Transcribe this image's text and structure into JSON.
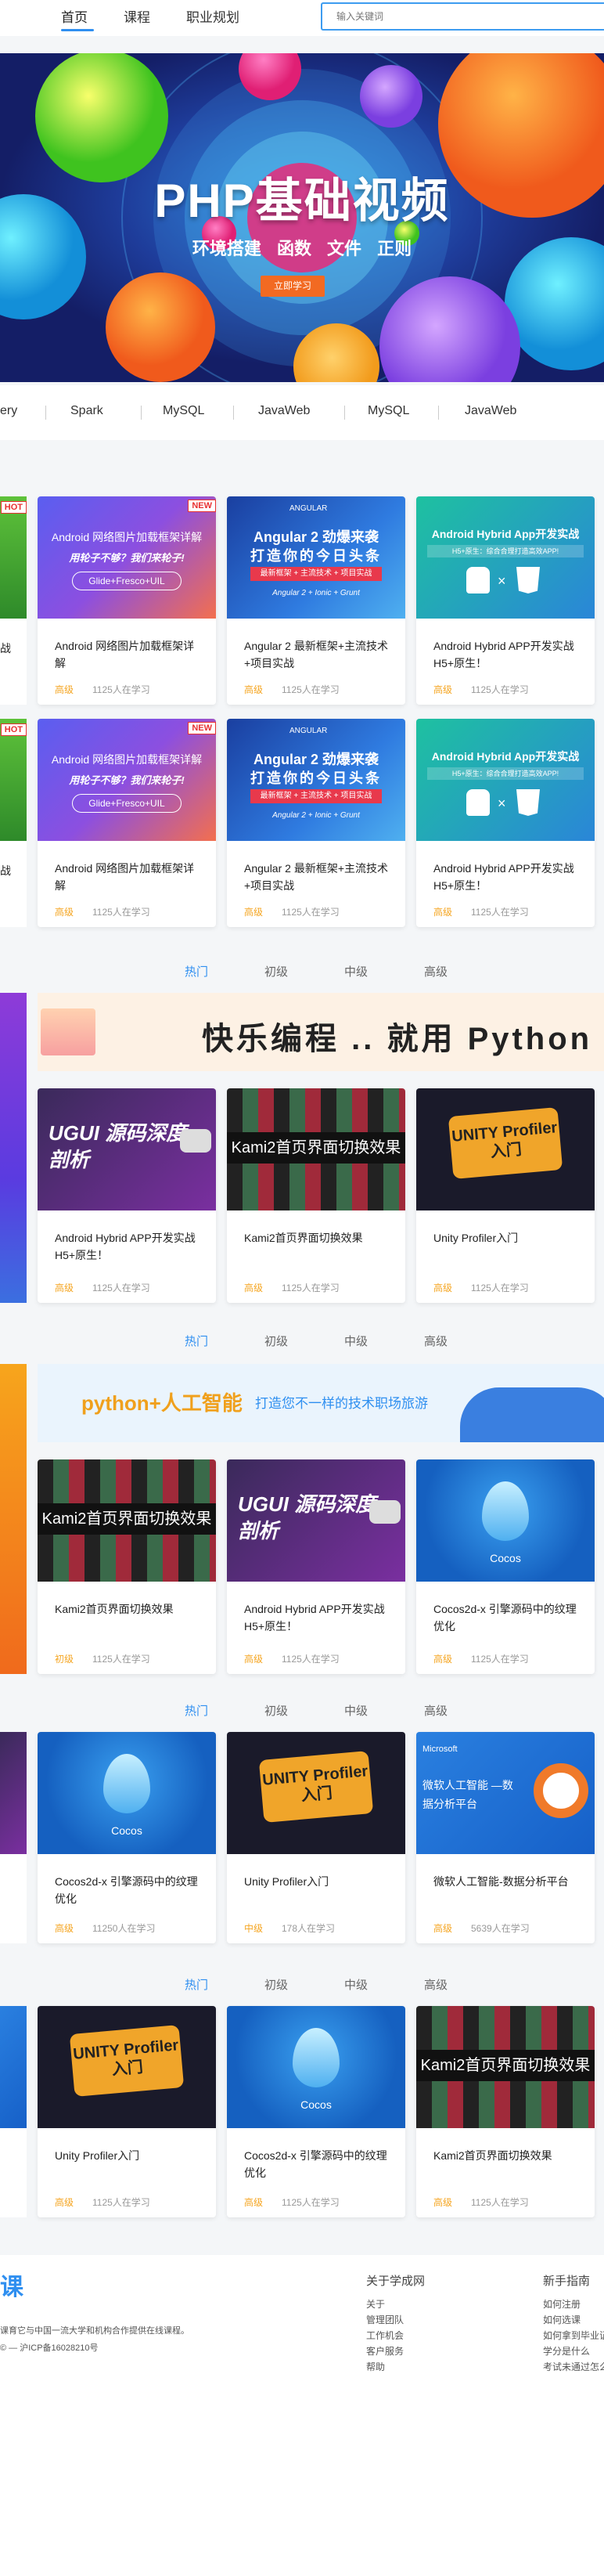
{
  "nav": {
    "items": [
      "首页",
      "课程",
      "职业规划"
    ],
    "search_placeholder": "输入关键词"
  },
  "banner": {
    "title": "PHP基础视频",
    "subtitle": "环境搭建 函数 文件 正则",
    "button": "立即学习",
    "dot_count": 7,
    "active_dot": 0
  },
  "categories": [
    "ery",
    "Spark",
    "MySQL",
    "JavaWeb",
    "MySQL",
    "JavaWeb"
  ],
  "top_cards": [
    {
      "title": "Android 网络图片加载框架详解",
      "level": "高级",
      "count": "1125人在学习",
      "thumb": {
        "line1": "Android 网络图片加载框架详解",
        "line2": "用轮子不够？我们来轮子!",
        "tag": "Glide+Fresco+UIL",
        "badge": "NEW"
      }
    },
    {
      "title": "Angular 2 最新框架+主流技术+项目实战",
      "level": "高级",
      "count": "1125人在学习",
      "thumb": {
        "line0": "ANGULAR",
        "line1": "Angular 2 劲爆来袭",
        "line2": "打造你的今日头条",
        "tag": "最新框架 + 主流技术 + 项目实战",
        "foot": "Angular 2 + Ionic + Grunt"
      }
    },
    {
      "title": "Android Hybrid APP开发实战 H5+原生！",
      "level": "高级",
      "count": "1125人在学习",
      "thumb": {
        "line1": "Android Hybrid App开发实战",
        "tag": "H5+原生：综合合理打造高效APP!"
      }
    }
  ],
  "left_badge": "HOT",
  "left_cut_title": "战",
  "left_cut_level": "战",
  "sections": [
    {
      "tabs": [
        "热门",
        "初级",
        "中级",
        "高级"
      ],
      "active": 0,
      "banner_text": "快乐编程 .. 就用 Python",
      "cards": [
        {
          "title": "Android Hybrid APP开发实战 H5+原生！",
          "level": "高级",
          "count": "1125人在学习",
          "thumb": "UGUI 源码深度剖析"
        },
        {
          "title": "Kami2首页界面切换效果",
          "level": "高级",
          "count": "1125人在学习",
          "thumb": "Kami2首页界面切换效果"
        },
        {
          "title": "Unity Profiler入门",
          "level": "高级",
          "count": "1125人在学习",
          "thumb": "UNITY Profiler 入门"
        }
      ]
    },
    {
      "tabs": [
        "热门",
        "初级",
        "中级",
        "高级"
      ],
      "active": 0,
      "banner_text": "python+人工智能",
      "banner_sub": "打造您不一样的技术职场旅游",
      "cards": [
        {
          "title": "Kami2首页界面切换效果",
          "level": "初级",
          "count": "1125人在学习",
          "thumb": "Kami2首页界面切换效果"
        },
        {
          "title": "Android Hybrid APP开发实战 H5+原生！",
          "level": "高级",
          "count": "1125人在学习",
          "thumb": "UGUI 源码深度剖析"
        },
        {
          "title": "Cocos2d-x 引擎源码中的纹理优化",
          "level": "高级",
          "count": "1125人在学习",
          "thumb": "Cocos"
        }
      ]
    },
    {
      "tabs": [
        "热门",
        "初级",
        "中级",
        "高级"
      ],
      "active": 0,
      "cards": [
        {
          "title": "Cocos2d-x 引擎源码中的纹理优化",
          "level": "高级",
          "count": "11250人在学习",
          "thumb": "Cocos"
        },
        {
          "title": "Unity Profiler入门",
          "level": "中级",
          "count": "178人在学习",
          "thumb": "UNITY Profiler 入门"
        },
        {
          "title": "微软人工智能-数据分析平台",
          "level": "高级",
          "count": "5639人在学习",
          "thumb": "微软人工智能 —数据分析平台",
          "thumb_logo": "Microsoft"
        }
      ]
    },
    {
      "tabs": [
        "热门",
        "初级",
        "中级",
        "高级"
      ],
      "active": 0,
      "cards": [
        {
          "title": "Unity Profiler入门",
          "level": "高级",
          "count": "1125人在学习",
          "thumb": "UNITY Profiler 入门"
        },
        {
          "title": "Cocos2d-x 引擎源码中的纹理优化",
          "level": "高级",
          "count": "1125人在学习",
          "thumb": "Cocos"
        },
        {
          "title": "Kami2首页界面切换效果",
          "level": "高级",
          "count": "1125人在学习",
          "thumb": "Kami2首页界面切换效果"
        }
      ]
    }
  ],
  "footer": {
    "logo": "课",
    "about_text": "课育它与中国一流大学和机构合作提供在线课程。",
    "icp": "© — 沪ICP备16028210号",
    "col1": {
      "title": "关于学成网",
      "links": [
        "关于",
        "管理团队",
        "工作机会",
        "客户服务",
        "帮助"
      ]
    },
    "col2": {
      "title": "新手指南",
      "links": [
        "如何注册",
        "如何选课",
        "如何拿到毕业证",
        "学分是什么",
        "考试未通过怎么"
      ]
    }
  },
  "colors": {
    "accent": "#2f8ff0",
    "level": "#f5a623",
    "orange_btn": "#f26a22"
  }
}
